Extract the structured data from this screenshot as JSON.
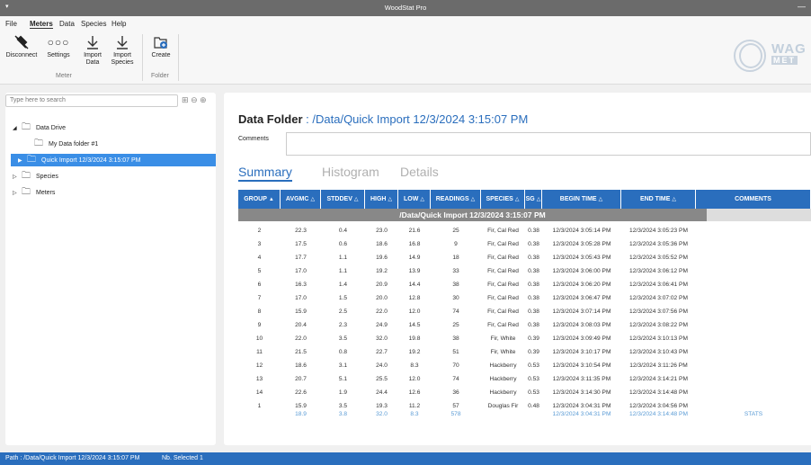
{
  "app": {
    "title": "WoodStat Pro",
    "minimize": "—"
  },
  "menu": [
    "File",
    "Meters",
    "Data",
    "Species",
    "Help"
  ],
  "ribbon": {
    "buttons": [
      {
        "label": "Disconnect",
        "icon": "disconnect-plug-icon"
      },
      {
        "label": "Settings",
        "icon": "settings-dots-icon"
      },
      {
        "label": "Import\nData",
        "icon": "import-arrow-icon"
      },
      {
        "label": "Import\nSpecies",
        "icon": "import-arrow-icon"
      },
      {
        "label": "Create",
        "icon": "create-folder-icon"
      }
    ],
    "groups": [
      "Meter",
      "Folder"
    ]
  },
  "logo": {
    "line1": "WAG",
    "line2": "MET",
    "tagline": ""
  },
  "search": {
    "placeholder": "Type here to search"
  },
  "tree": [
    {
      "label": "Data Drive",
      "expanded": true
    },
    {
      "label": "My Data folder #1"
    },
    {
      "label": "Quick Import 12/3/2024 3:15:07 PM",
      "selected": true
    },
    {
      "label": "Species"
    },
    {
      "label": "Meters"
    }
  ],
  "main": {
    "title_prefix": "Data Folder",
    "title_sep": ":",
    "title_path": "/Data/Quick Import 12/3/2024 3:15:07 PM",
    "comments_label": "Comments",
    "comments_value": "",
    "tabs": [
      "Summary",
      "Histogram",
      "Details"
    ],
    "active_tab": "Summary"
  },
  "table": {
    "columns": [
      {
        "label": "GROUP",
        "sort": "▲"
      },
      {
        "label": "AVGMC",
        "sort": "△"
      },
      {
        "label": "STDDEV",
        "sort": "△"
      },
      {
        "label": "HIGH",
        "sort": "△"
      },
      {
        "label": "LOW",
        "sort": "△"
      },
      {
        "label": "READINGS",
        "sort": "△"
      },
      {
        "label": "SPECIES",
        "sort": "△"
      },
      {
        "label": "SG",
        "sort": "△"
      },
      {
        "label": "BEGIN TIME",
        "sort": "△"
      },
      {
        "label": "END TIME",
        "sort": "△"
      },
      {
        "label": "COMMENTS",
        "sort": ""
      }
    ],
    "group_label": "/Data/Quick Import 12/3/2024 3:15:07 PM",
    "rows": [
      [
        "2",
        "22.3",
        "0.4",
        "23.0",
        "21.6",
        "25",
        "Fir, Cal Red",
        "0.38",
        "12/3/2024 3:05:14 PM",
        "12/3/2024 3:05:23 PM",
        ""
      ],
      [
        "3",
        "17.5",
        "0.6",
        "18.6",
        "16.8",
        "9",
        "Fir, Cal Red",
        "0.38",
        "12/3/2024 3:05:28 PM",
        "12/3/2024 3:05:36 PM",
        ""
      ],
      [
        "4",
        "17.7",
        "1.1",
        "19.6",
        "14.9",
        "18",
        "Fir, Cal Red",
        "0.38",
        "12/3/2024 3:05:43 PM",
        "12/3/2024 3:05:52 PM",
        ""
      ],
      [
        "5",
        "17.0",
        "1.1",
        "19.2",
        "13.9",
        "33",
        "Fir, Cal Red",
        "0.38",
        "12/3/2024 3:06:00 PM",
        "12/3/2024 3:06:12 PM",
        ""
      ],
      [
        "6",
        "16.3",
        "1.4",
        "20.9",
        "14.4",
        "38",
        "Fir, Cal Red",
        "0.38",
        "12/3/2024 3:06:20 PM",
        "12/3/2024 3:06:41 PM",
        ""
      ],
      [
        "7",
        "17.0",
        "1.5",
        "20.0",
        "12.8",
        "30",
        "Fir, Cal Red",
        "0.38",
        "12/3/2024 3:06:47 PM",
        "12/3/2024 3:07:02 PM",
        ""
      ],
      [
        "8",
        "15.9",
        "2.5",
        "22.0",
        "12.0",
        "74",
        "Fir, Cal Red",
        "0.38",
        "12/3/2024 3:07:14 PM",
        "12/3/2024 3:07:56 PM",
        ""
      ],
      [
        "9",
        "20.4",
        "2.3",
        "24.9",
        "14.5",
        "25",
        "Fir, Cal Red",
        "0.38",
        "12/3/2024 3:08:03 PM",
        "12/3/2024 3:08:22 PM",
        ""
      ],
      [
        "10",
        "22.0",
        "3.5",
        "32.0",
        "19.8",
        "38",
        "Fir, White",
        "0.39",
        "12/3/2024 3:09:49 PM",
        "12/3/2024 3:10:13 PM",
        ""
      ],
      [
        "11",
        "21.5",
        "0.8",
        "22.7",
        "19.2",
        "51",
        "Fir, White",
        "0.39",
        "12/3/2024 3:10:17 PM",
        "12/3/2024 3:10:43 PM",
        ""
      ],
      [
        "12",
        "18.6",
        "3.1",
        "24.0",
        "8.3",
        "70",
        "Hackberry",
        "0.53",
        "12/3/2024 3:10:54 PM",
        "12/3/2024 3:11:26 PM",
        ""
      ],
      [
        "13",
        "20.7",
        "5.1",
        "25.5",
        "12.0",
        "74",
        "Hackberry",
        "0.53",
        "12/3/2024 3:11:35 PM",
        "12/3/2024 3:14:21 PM",
        ""
      ],
      [
        "14",
        "22.6",
        "1.9",
        "24.4",
        "12.6",
        "36",
        "Hackberry",
        "0.53",
        "12/3/2024 3:14:30 PM",
        "12/3/2024 3:14:48 PM",
        ""
      ],
      [
        "1",
        "15.9",
        "3.5",
        "19.3",
        "11.2",
        "57",
        "Douglas Fir",
        "0.48",
        "12/3/2024 3:04:31 PM",
        "12/3/2024 3:04:56 PM",
        ""
      ]
    ],
    "stats": [
      "",
      "18.9",
      "3.8",
      "32.0",
      "8.3",
      "578",
      "",
      "",
      "12/3/2024 3:04:31 PM",
      "12/3/2024 3:14:48 PM",
      "STATS"
    ]
  },
  "status": {
    "path": "Path : /Data/Quick Import 12/3/2024 3:15:07 PM",
    "selected": "Nb. Selected 1"
  },
  "colors": {
    "accent": "#2a6ebd",
    "selected": "#3a8ee6",
    "group_bar": "#888888",
    "stats_text": "#5a9bd5"
  }
}
